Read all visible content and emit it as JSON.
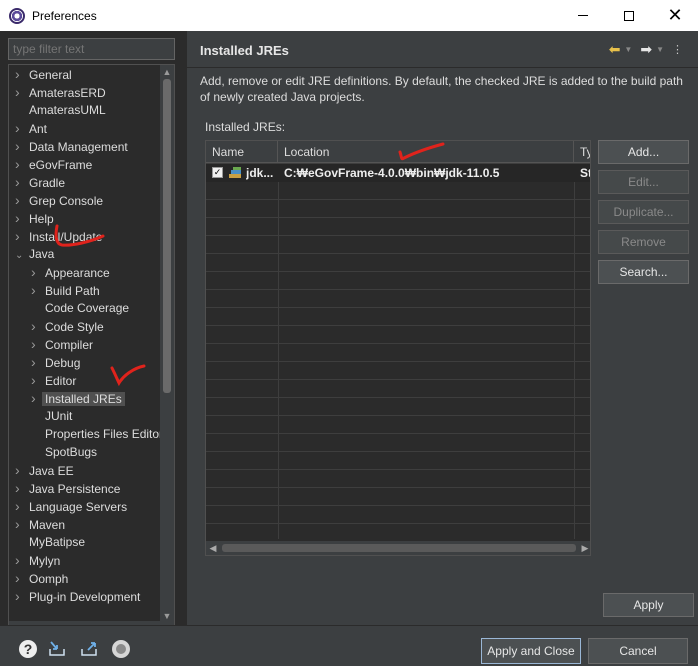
{
  "window": {
    "title": "Preferences"
  },
  "filter": {
    "placeholder": "type filter text"
  },
  "tree": {
    "items": [
      {
        "label": "General",
        "chevron": "right"
      },
      {
        "label": "AmaterasERD",
        "chevron": "right"
      },
      {
        "label": "AmaterasUML",
        "chevron": ""
      },
      {
        "label": "Ant",
        "chevron": "right"
      },
      {
        "label": "Data Management",
        "chevron": "right"
      },
      {
        "label": "eGovFrame",
        "chevron": "right"
      },
      {
        "label": "Gradle",
        "chevron": "right"
      },
      {
        "label": "Grep Console",
        "chevron": "right"
      },
      {
        "label": "Help",
        "chevron": "right"
      },
      {
        "label": "Install/Update",
        "chevron": "right"
      },
      {
        "label": "Java",
        "chevron": "down"
      },
      {
        "label": "Appearance",
        "chevron": "right"
      },
      {
        "label": "Build Path",
        "chevron": "right"
      },
      {
        "label": "Code Coverage",
        "chevron": ""
      },
      {
        "label": "Code Style",
        "chevron": "right"
      },
      {
        "label": "Compiler",
        "chevron": "right"
      },
      {
        "label": "Debug",
        "chevron": "right"
      },
      {
        "label": "Editor",
        "chevron": "right"
      },
      {
        "label": "Installed JREs",
        "chevron": "right"
      },
      {
        "label": "JUnit",
        "chevron": ""
      },
      {
        "label": "Properties Files Editor",
        "chevron": ""
      },
      {
        "label": "SpotBugs",
        "chevron": ""
      },
      {
        "label": "Java EE",
        "chevron": "right"
      },
      {
        "label": "Java Persistence",
        "chevron": "right"
      },
      {
        "label": "Language Servers",
        "chevron": "right"
      },
      {
        "label": "Maven",
        "chevron": "right"
      },
      {
        "label": "MyBatipse",
        "chevron": ""
      },
      {
        "label": "Mylyn",
        "chevron": "right"
      },
      {
        "label": "Oomph",
        "chevron": "right"
      },
      {
        "label": "Plug-in Development",
        "chevron": "right"
      }
    ]
  },
  "page": {
    "title": "Installed JREs",
    "description": "Add, remove or edit JRE definitions. By default, the checked JRE is added to the build path of newly created Java projects.",
    "section_label": "Installed JREs:"
  },
  "table": {
    "columns": [
      "Name",
      "Location",
      "Ty"
    ],
    "rows": [
      {
        "checked": true,
        "name": "jdk...",
        "location": "C:₩eGovFrame-4.0.0₩bin₩jdk-11.0.5",
        "type": "St"
      }
    ]
  },
  "buttons": {
    "add": "Add...",
    "edit": "Edit...",
    "duplicate": "Duplicate...",
    "remove": "Remove",
    "search": "Search...",
    "apply": "Apply",
    "apply_and_close": "Apply and Close",
    "cancel": "Cancel"
  },
  "colors": {
    "annotation_red": "#e0231c"
  }
}
